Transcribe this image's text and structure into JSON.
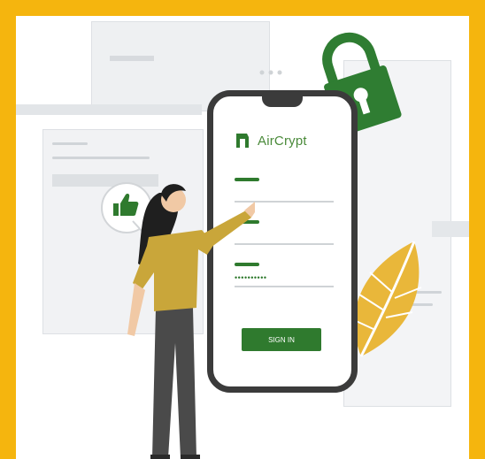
{
  "brand": {
    "name": "AirCrypt"
  },
  "login": {
    "username_value": "",
    "email_value": "",
    "password_value": "••••••••••",
    "signin_label": "SIGN IN"
  },
  "colors": {
    "frame": "#f5b50e",
    "accent_green": "#2f7a2e",
    "lock_green": "#2f7d32",
    "leaf_yellow": "#e9b73a",
    "shirt": "#c9a63a",
    "pants": "#4a4a4a"
  },
  "icons": [
    "lock-icon",
    "thumbs-up-icon",
    "leaf-icon",
    "brand-logo-icon"
  ]
}
